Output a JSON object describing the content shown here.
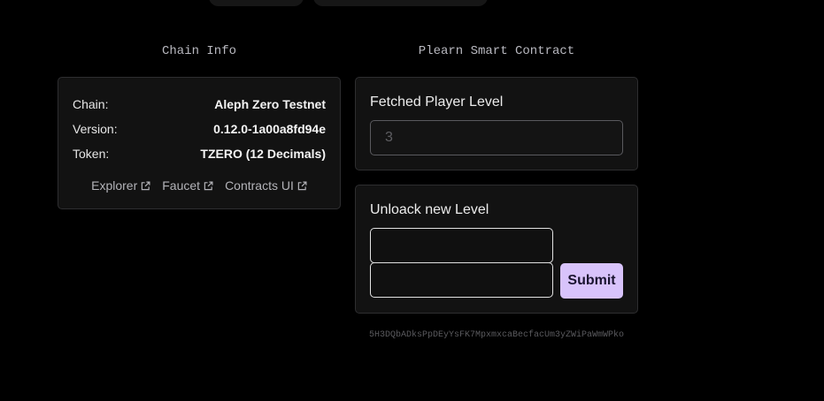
{
  "chain_info": {
    "title": "Chain Info",
    "rows": [
      {
        "label": "Chain:",
        "value": "Aleph Zero Testnet"
      },
      {
        "label": "Version:",
        "value": "0.12.0-1a00a8fd94e"
      },
      {
        "label": "Token:",
        "value": "TZERO (12 Decimals)"
      }
    ],
    "links": [
      {
        "label": "Explorer",
        "icon": "external-link-icon"
      },
      {
        "label": "Faucet",
        "icon": "external-link-icon"
      },
      {
        "label": "Contracts UI",
        "icon": "external-link-icon"
      }
    ]
  },
  "contract": {
    "title": "Plearn Smart Contract",
    "fetched": {
      "heading": "Fetched Player Level",
      "value": "3"
    },
    "unlock": {
      "heading": "Unloack new Level",
      "input1": "",
      "input2": "",
      "submit_label": "Submit"
    },
    "address": "5H3DQbADksPpDEyYsFK7MpxmxcaBecfacUm3yZWiPaWmWPko"
  },
  "colors": {
    "accent": "#d8c3fb",
    "card_bg": "#121212",
    "border": "#2e2e30"
  }
}
